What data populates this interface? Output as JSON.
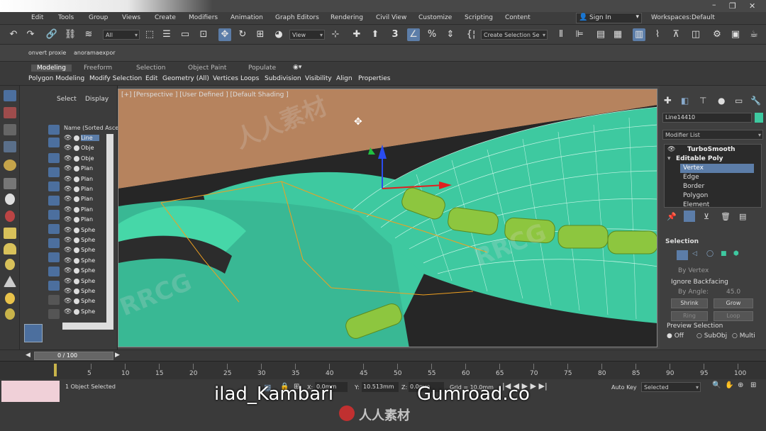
{
  "menubar": {
    "items": [
      "Edit",
      "Tools",
      "Group",
      "Views",
      "Create",
      "Modifiers",
      "Animation",
      "Graph Editors",
      "Rendering",
      "Civil View",
      "Customize",
      "Scripting",
      "Content"
    ],
    "sign_in": "Sign In",
    "workspaces_label": "Workspaces:",
    "workspace_value": "Default"
  },
  "toolbar": {
    "selection_filter": "All",
    "view_combo": "View",
    "snap_label": "3",
    "selection_set": "Create Selection Se"
  },
  "toolbar2": {
    "items": [
      "onvert proxie",
      "anoramaexpor"
    ]
  },
  "ribbon": {
    "tabs": [
      "Modeling",
      "Freeform",
      "Selection",
      "Object Paint",
      "Populate"
    ],
    "sub_items": [
      "Polygon Modeling",
      "Modify Selection",
      "Edit",
      "Geometry (All)",
      "Vertices",
      "Loops",
      "Subdivision",
      "Visibility",
      "Align",
      "Properties"
    ]
  },
  "scene_explorer": {
    "tabs": [
      "Select",
      "Display"
    ],
    "column_header": "Name (Sorted Asce",
    "rows": [
      "Line",
      "Obje",
      "Obje",
      "Plan",
      "Plan",
      "Plan",
      "Plan",
      "Plan",
      "Plan",
      "Sphe",
      "Sphe",
      "Sphe",
      "Sphe",
      "Sphe",
      "Sphe",
      "Sphe",
      "Sphe",
      "Sphe"
    ]
  },
  "viewport": {
    "label": "[+] [Perspective ] [User Defined ] [Default Shading ]"
  },
  "command_panel": {
    "object_name": "Line14410",
    "modifier_list": "Modifier List",
    "stack": [
      "TurboSmooth",
      "Editable Poly",
      "Vertex",
      "Edge",
      "Border",
      "Polygon",
      "Element"
    ],
    "selection_title": "Selection",
    "by_vertex": "By Vertex",
    "ignore_backfacing": "Ignore Backfacing",
    "by_angle": "By Angle:",
    "angle_value": "45.0",
    "shrink": "Shrink",
    "grow": "Grow",
    "ring": "Ring",
    "loop": "Loop",
    "preview_selection": "Preview Selection",
    "preview_options": [
      "Off",
      "SubObj",
      "Multi"
    ]
  },
  "timeline": {
    "frame": "0 / 100",
    "ticks": [
      "5",
      "10",
      "15",
      "20",
      "25",
      "30",
      "35",
      "40",
      "45",
      "50",
      "55",
      "60",
      "65",
      "70",
      "75",
      "80",
      "85",
      "90",
      "95",
      "100"
    ]
  },
  "status": {
    "selected": "1 Object Selected",
    "x_label": "X:",
    "x_value": "0.0mm",
    "y_label": "Y:",
    "y_value": "10.513mm",
    "z_label": "Z:",
    "z_value": "0.0mm",
    "grid": "Grid = 10.0mm",
    "auto_key": "Auto Key",
    "selected_combo": "Selected"
  },
  "overlay": {
    "left_text": "ilad_Kambari",
    "right_text": "Gumroad.co",
    "watermark_rrcg": "RRCG",
    "watermark_cn": "人人素材"
  },
  "colors": {
    "mesh": "#3ec9a0",
    "floor": "#b6835e",
    "accent": "#5c7da8",
    "pad": "#8dc63f",
    "wire": "#f0a020"
  }
}
